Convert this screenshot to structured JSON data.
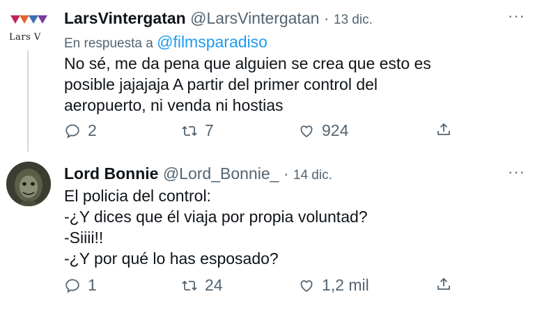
{
  "tweets": [
    {
      "avatar_text": "Lars V",
      "name": "LarsVintergatan",
      "handle": "@LarsVintergatan",
      "separator": "·",
      "date": "13 dic.",
      "reply_prefix": "En respuesta a",
      "reply_mention": "@filmsparadiso",
      "body_lines": [
        "No sé, me da pena que alguien se crea que esto es",
        "posible jajajaja A partir del primer control del",
        "aeropuerto, ni venda ni hostias"
      ],
      "replies": "2",
      "retweets": "7",
      "likes": "924",
      "more": "···"
    },
    {
      "name": "Lord Bonnie",
      "handle": "@Lord_Bonnie_",
      "separator": "·",
      "date": "14 dic.",
      "body_lines": [
        "El policia del control:",
        "-¿Y dices que él viaja por propia voluntad?",
        "-Siiii!!",
        "-¿Y por qué lo has esposado?"
      ],
      "replies": "1",
      "retweets": "24",
      "likes": "1,2 mil",
      "more": "···"
    }
  ],
  "icons": {
    "reply": "reply-icon",
    "retweet": "retweet-icon",
    "like": "heart-icon",
    "share": "share-icon",
    "more": "more-icon"
  },
  "colors": {
    "mention": "#1d9bf0",
    "secondary_text": "#536471",
    "primary_text": "#0f1419"
  }
}
